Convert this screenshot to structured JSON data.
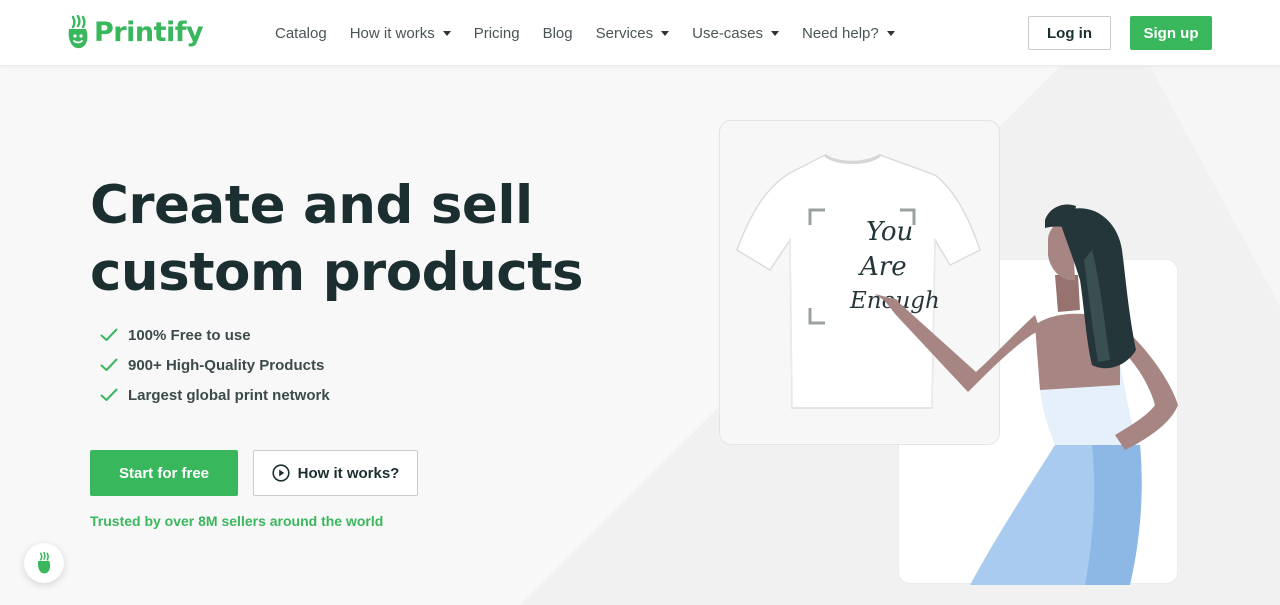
{
  "header": {
    "logo_text": "Printify",
    "nav": [
      {
        "label": "Catalog",
        "has_caret": false
      },
      {
        "label": "How it works",
        "has_caret": true
      },
      {
        "label": "Pricing",
        "has_caret": false
      },
      {
        "label": "Blog",
        "has_caret": false
      },
      {
        "label": "Services",
        "has_caret": true
      },
      {
        "label": "Use-cases",
        "has_caret": true
      },
      {
        "label": "Need help?",
        "has_caret": true
      }
    ],
    "login_label": "Log in",
    "signup_label": "Sign up"
  },
  "hero": {
    "title_line1": "Create and sell",
    "title_line2": "custom products",
    "features": [
      "100% Free to use",
      "900+ High-Quality Products",
      "Largest global print network"
    ],
    "start_label": "Start for free",
    "how_label": "How it works?",
    "trusted_text": "Trusted by over 8M sellers around the world"
  },
  "illustration": {
    "shirt_text": [
      "You",
      "Are",
      "Enough"
    ]
  },
  "colors": {
    "brand_green": "#39b75d",
    "text_dark": "#1b2e30"
  },
  "icons": {
    "logo": "printify-logo-icon",
    "check": "check-icon",
    "play": "play-circle-icon",
    "chat": "chat-bubble-icon"
  }
}
